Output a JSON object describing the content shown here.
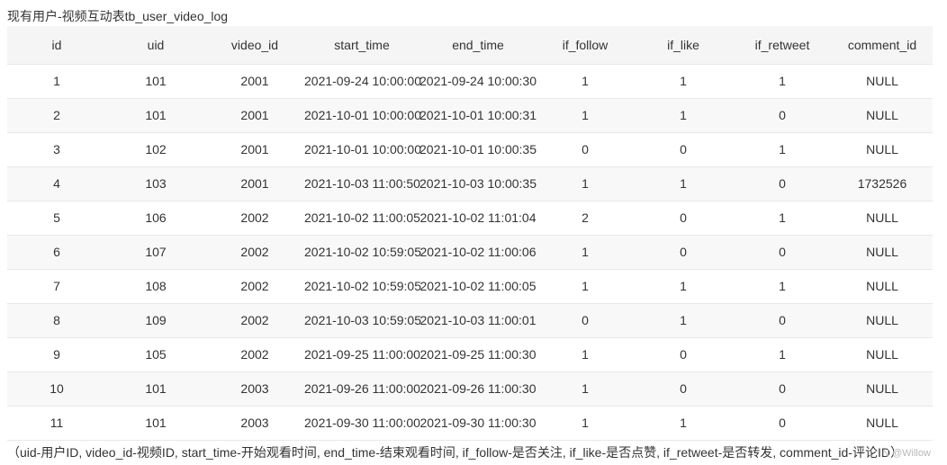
{
  "caption": "现有用户-视频互动表tb_user_video_log",
  "table": {
    "columns": [
      "id",
      "uid",
      "video_id",
      "start_time",
      "end_time",
      "if_follow",
      "if_like",
      "if_retweet",
      "comment_id"
    ],
    "rows": [
      [
        "1",
        "101",
        "2001",
        "2021-09-24 10:00:00",
        "2021-09-24 10:00:30",
        "1",
        "1",
        "1",
        "NULL"
      ],
      [
        "2",
        "101",
        "2001",
        "2021-10-01 10:00:00",
        "2021-10-01 10:00:31",
        "1",
        "1",
        "0",
        "NULL"
      ],
      [
        "3",
        "102",
        "2001",
        "2021-10-01 10:00:00",
        "2021-10-01 10:00:35",
        "0",
        "0",
        "1",
        "NULL"
      ],
      [
        "4",
        "103",
        "2001",
        "2021-10-03 11:00:50",
        "2021-10-03 10:00:35",
        "1",
        "1",
        "0",
        "1732526"
      ],
      [
        "5",
        "106",
        "2002",
        "2021-10-02 11:00:05",
        "2021-10-02 11:01:04",
        "2",
        "0",
        "1",
        "NULL"
      ],
      [
        "6",
        "107",
        "2002",
        "2021-10-02 10:59:05",
        "2021-10-02 11:00:06",
        "1",
        "0",
        "0",
        "NULL"
      ],
      [
        "7",
        "108",
        "2002",
        "2021-10-02 10:59:05",
        "2021-10-02 11:00:05",
        "1",
        "1",
        "1",
        "NULL"
      ],
      [
        "8",
        "109",
        "2002",
        "2021-10-03 10:59:05",
        "2021-10-03 11:00:01",
        "0",
        "1",
        "0",
        "NULL"
      ],
      [
        "9",
        "105",
        "2002",
        "2021-09-25 11:00:00",
        "2021-09-25 11:00:30",
        "1",
        "0",
        "1",
        "NULL"
      ],
      [
        "10",
        "101",
        "2003",
        "2021-09-26 11:00:00",
        "2021-09-26 11:00:30",
        "1",
        "0",
        "0",
        "NULL"
      ],
      [
        "11",
        "101",
        "2003",
        "2021-09-30 11:00:00",
        "2021-09-30 11:00:30",
        "1",
        "1",
        "0",
        "NULL"
      ]
    ]
  },
  "footnote": "（uid-用户ID, video_id-视频ID, start_time-开始观看时间, end_time-结束观看时间, if_follow-是否关注, if_like-是否点赞, if_retweet-是否转发, comment_id-评论ID）",
  "watermark": "N @Willow"
}
